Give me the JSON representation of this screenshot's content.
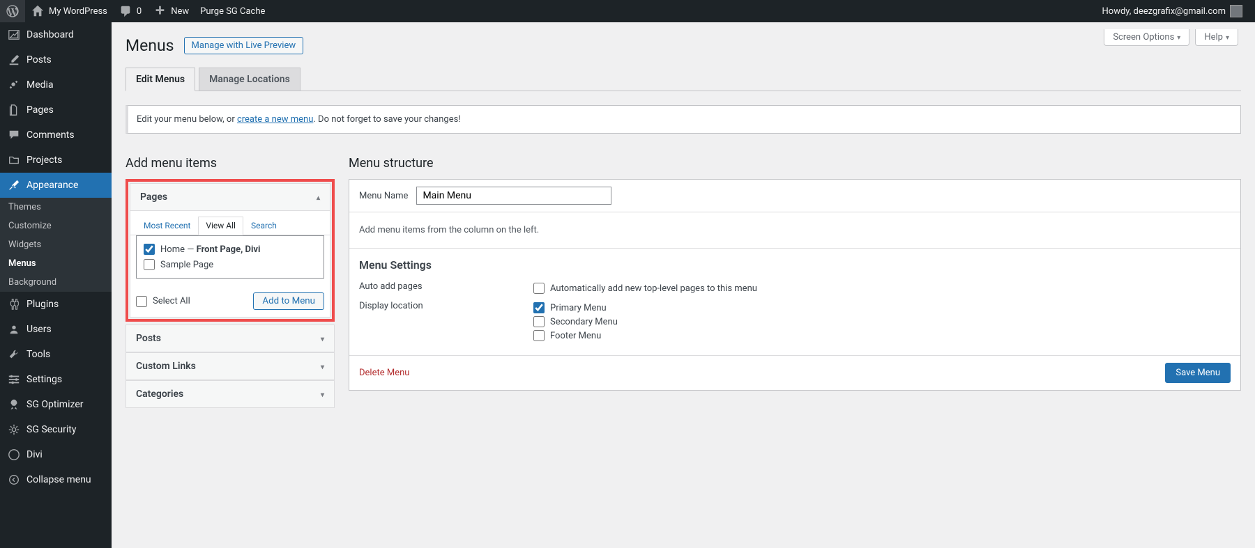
{
  "adminbar": {
    "site_name": "My WordPress",
    "comments_count": "0",
    "new_label": "New",
    "purge_label": "Purge SG Cache",
    "howdy": "Howdy, deezgrafix@gmail.com"
  },
  "screen": {
    "options_label": "Screen Options",
    "help_label": "Help"
  },
  "sidebar": {
    "dashboard": "Dashboard",
    "posts": "Posts",
    "media": "Media",
    "pages": "Pages",
    "comments": "Comments",
    "projects": "Projects",
    "appearance": "Appearance",
    "sub": {
      "themes": "Themes",
      "customize": "Customize",
      "widgets": "Widgets",
      "menus": "Menus",
      "background": "Background"
    },
    "plugins": "Plugins",
    "users": "Users",
    "tools": "Tools",
    "settings": "Settings",
    "sg_optimizer": "SG Optimizer",
    "sg_security": "SG Security",
    "divi": "Divi",
    "collapse": "Collapse menu"
  },
  "header": {
    "title": "Menus",
    "live_preview": "Manage with Live Preview"
  },
  "tabs": {
    "edit": "Edit Menus",
    "locations": "Manage Locations"
  },
  "notice": {
    "before": "Edit your menu below, or ",
    "link": "create a new menu",
    "after": ". Do not forget to save your changes!"
  },
  "left_col": {
    "title": "Add menu items",
    "pages": {
      "heading": "Pages",
      "tab_recent": "Most Recent",
      "tab_viewall": "View All",
      "tab_search": "Search",
      "item_home_prefix": "Home — ",
      "item_home_strong": "Front Page, Divi",
      "item_sample": "Sample Page",
      "select_all": "Select All",
      "add_btn": "Add to Menu"
    },
    "posts": "Posts",
    "custom_links": "Custom Links",
    "categories": "Categories"
  },
  "right_col": {
    "title": "Menu structure",
    "menu_name_label": "Menu Name",
    "menu_name_value": "Main Menu",
    "body_hint": "Add menu items from the column on the left.",
    "settings": {
      "heading": "Menu Settings",
      "auto_add_label": "Auto add pages",
      "auto_add_opt": "Automatically add new top-level pages to this menu",
      "display_label": "Display location",
      "loc_primary": "Primary Menu",
      "loc_secondary": "Secondary Menu",
      "loc_footer": "Footer Menu"
    },
    "delete": "Delete Menu",
    "save": "Save Menu"
  }
}
